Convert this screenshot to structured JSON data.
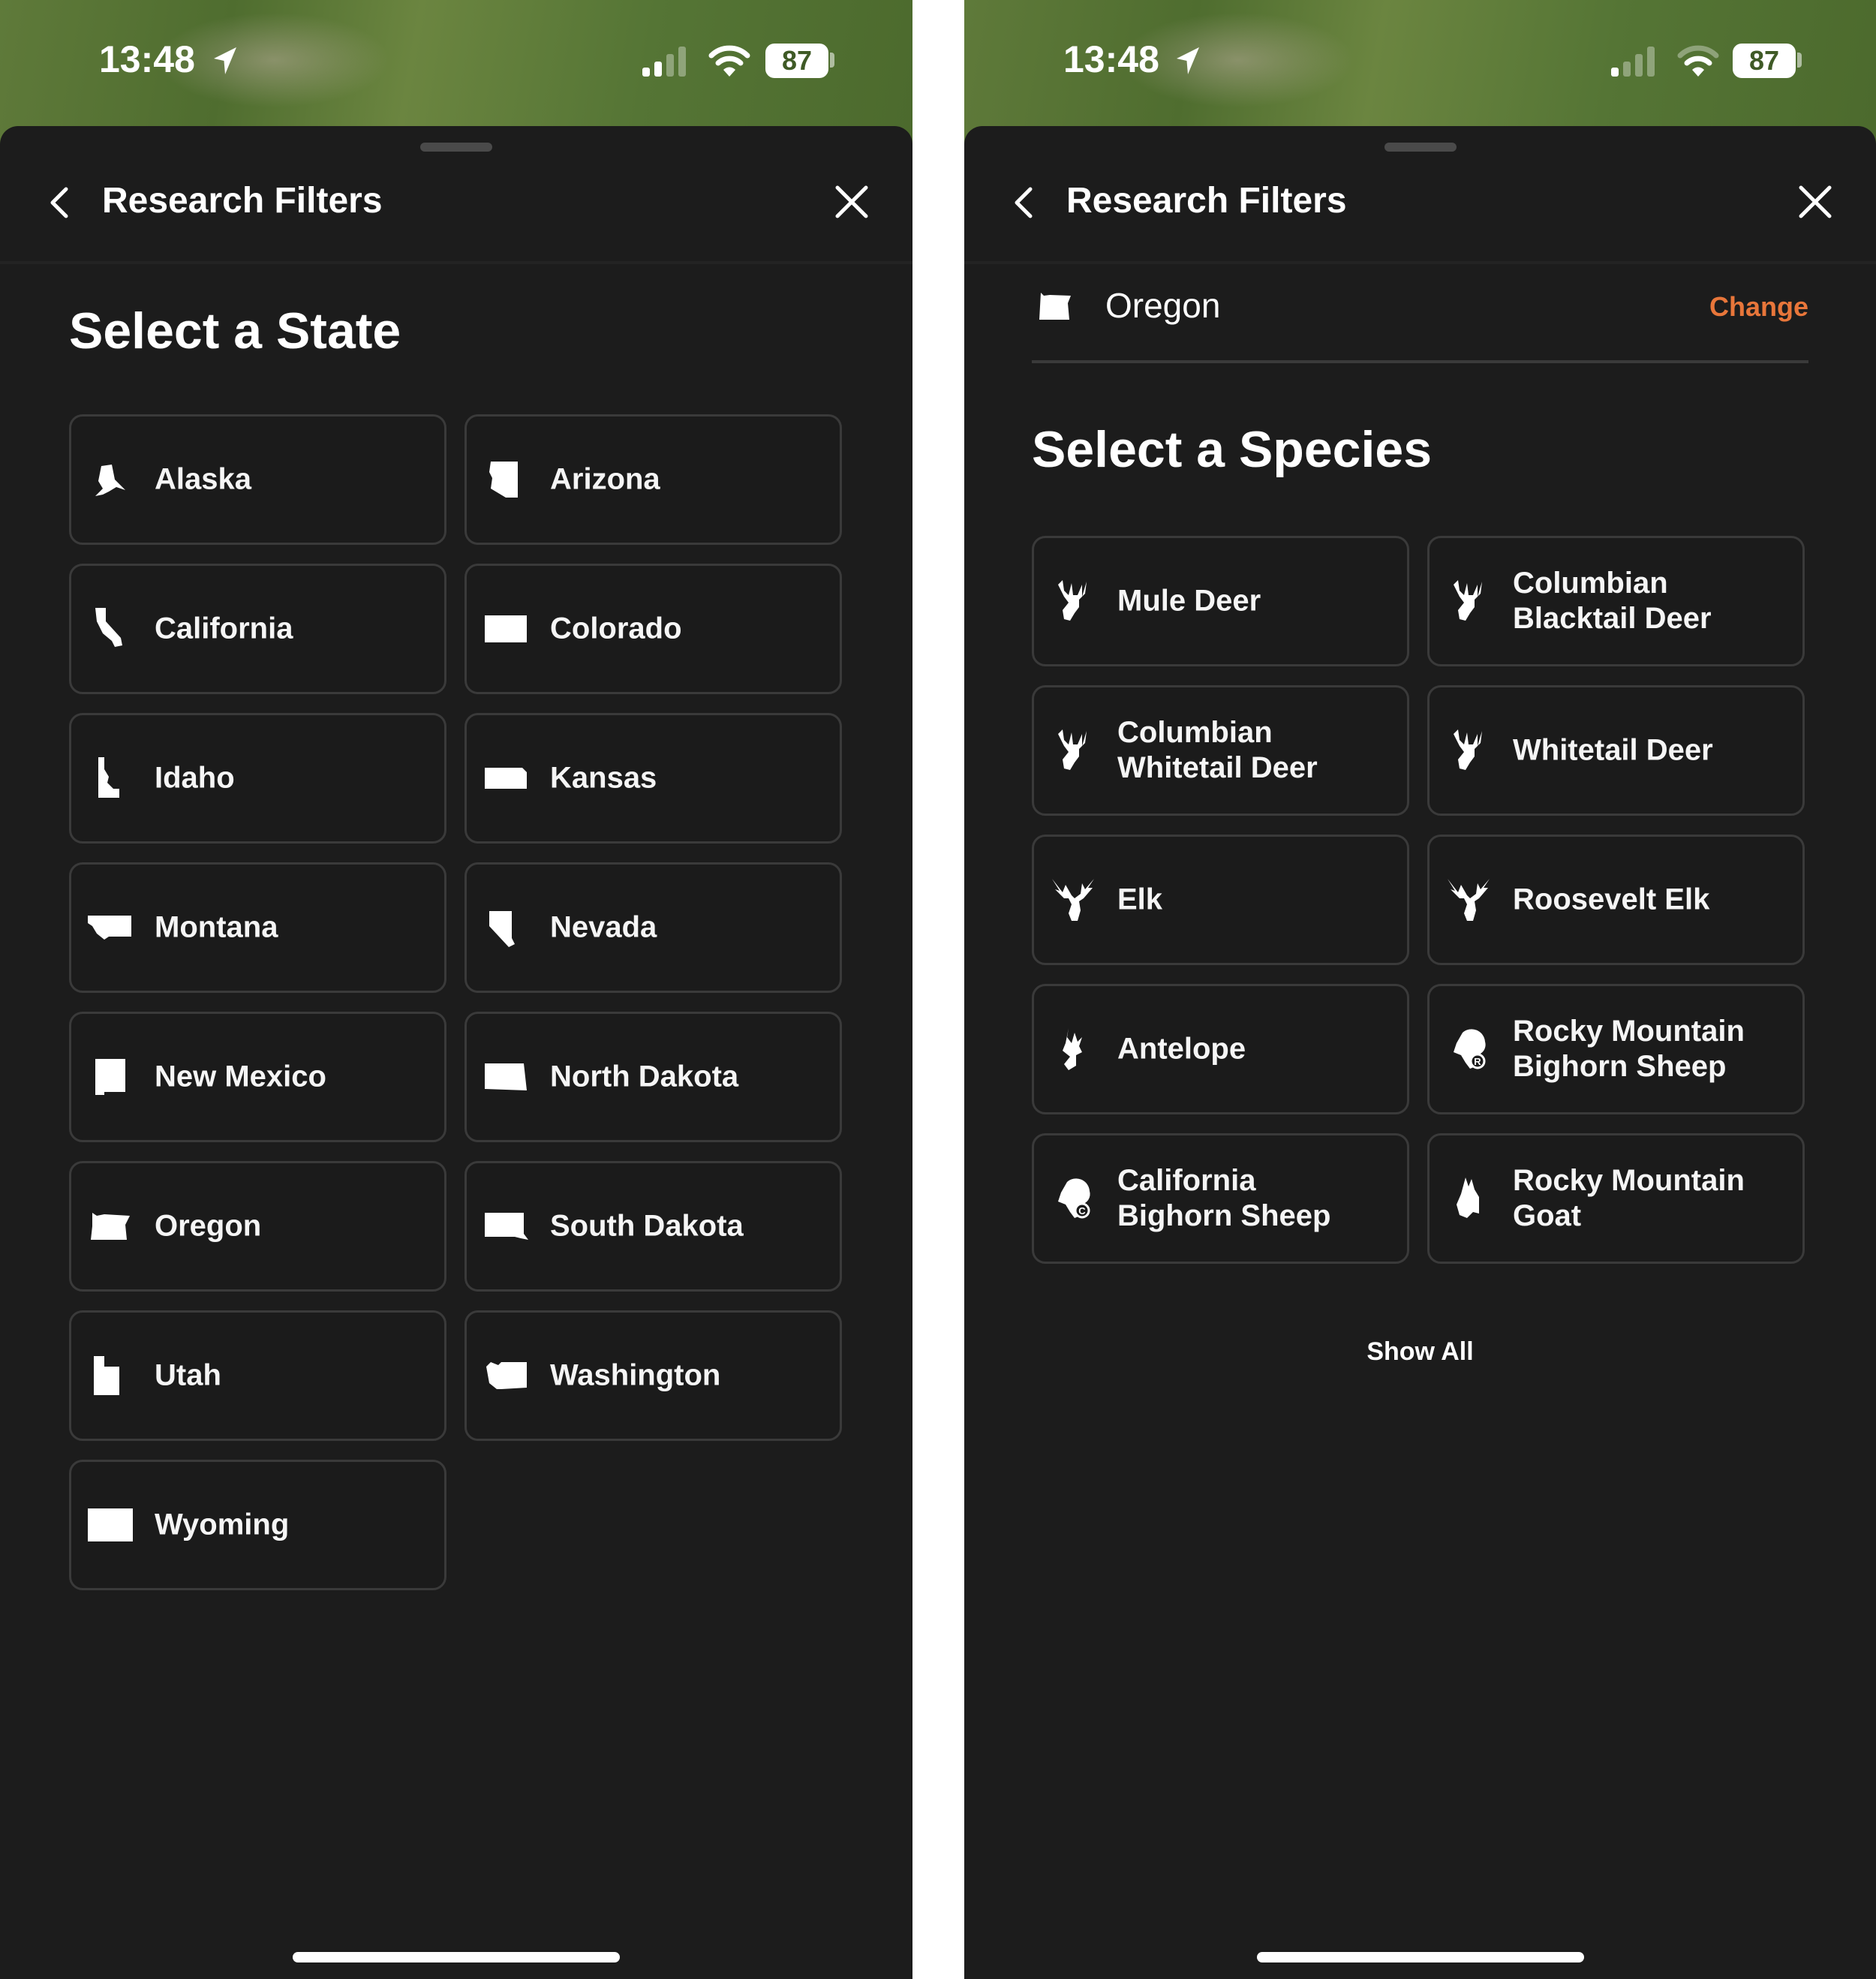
{
  "status_bar": {
    "time": "13:48",
    "battery": "87",
    "icons": [
      "location-arrow-icon",
      "cellular-signal-icon",
      "wifi-icon",
      "battery-icon"
    ]
  },
  "screens": [
    {
      "header": {
        "title": "Research Filters",
        "back_icon": "chevron-left-icon",
        "close_icon": "close-icon"
      },
      "section_title": "Select a State",
      "states": [
        {
          "label": "Alaska",
          "icon": "alaska-shape-icon"
        },
        {
          "label": "Arizona",
          "icon": "arizona-shape-icon"
        },
        {
          "label": "California",
          "icon": "california-shape-icon"
        },
        {
          "label": "Colorado",
          "icon": "colorado-shape-icon"
        },
        {
          "label": "Idaho",
          "icon": "idaho-shape-icon"
        },
        {
          "label": "Kansas",
          "icon": "kansas-shape-icon"
        },
        {
          "label": "Montana",
          "icon": "montana-shape-icon"
        },
        {
          "label": "Nevada",
          "icon": "nevada-shape-icon"
        },
        {
          "label": "New Mexico",
          "icon": "new-mexico-shape-icon"
        },
        {
          "label": "North Dakota",
          "icon": "north-dakota-shape-icon"
        },
        {
          "label": "Oregon",
          "icon": "oregon-shape-icon"
        },
        {
          "label": "South Dakota",
          "icon": "south-dakota-shape-icon"
        },
        {
          "label": "Utah",
          "icon": "utah-shape-icon"
        },
        {
          "label": "Washington",
          "icon": "washington-shape-icon"
        },
        {
          "label": "Wyoming",
          "icon": "wyoming-shape-icon"
        }
      ]
    },
    {
      "header": {
        "title": "Research Filters",
        "back_icon": "chevron-left-icon",
        "close_icon": "close-icon"
      },
      "selected_state": {
        "label": "Oregon",
        "icon": "oregon-shape-icon",
        "change_label": "Change"
      },
      "section_title": "Select a Species",
      "species": [
        {
          "label": "Mule Deer",
          "icon": "deer-head-icon"
        },
        {
          "label": "Columbian\nBlacktail Deer",
          "icon": "deer-head-icon"
        },
        {
          "label": "Columbian\nWhitetail Deer",
          "icon": "deer-head-icon"
        },
        {
          "label": "Whitetail Deer",
          "icon": "deer-head-icon"
        },
        {
          "label": "Elk",
          "icon": "elk-head-icon"
        },
        {
          "label": "Roosevelt Elk",
          "icon": "elk-head-icon"
        },
        {
          "label": "Antelope",
          "icon": "antelope-head-icon"
        },
        {
          "label": "Rocky Mountain\nBighorn Sheep",
          "icon": "ram-head-r-icon"
        },
        {
          "label": "California\nBighorn Sheep",
          "icon": "ram-head-c-icon"
        },
        {
          "label": "Rocky Mountain\nGoat",
          "icon": "goat-head-icon"
        }
      ],
      "show_all_label": "Show All"
    }
  ],
  "colors": {
    "background": "#1c1c1c",
    "card_border": "#3a3a3a",
    "accent": "#e8763a",
    "text": "#ffffff"
  }
}
